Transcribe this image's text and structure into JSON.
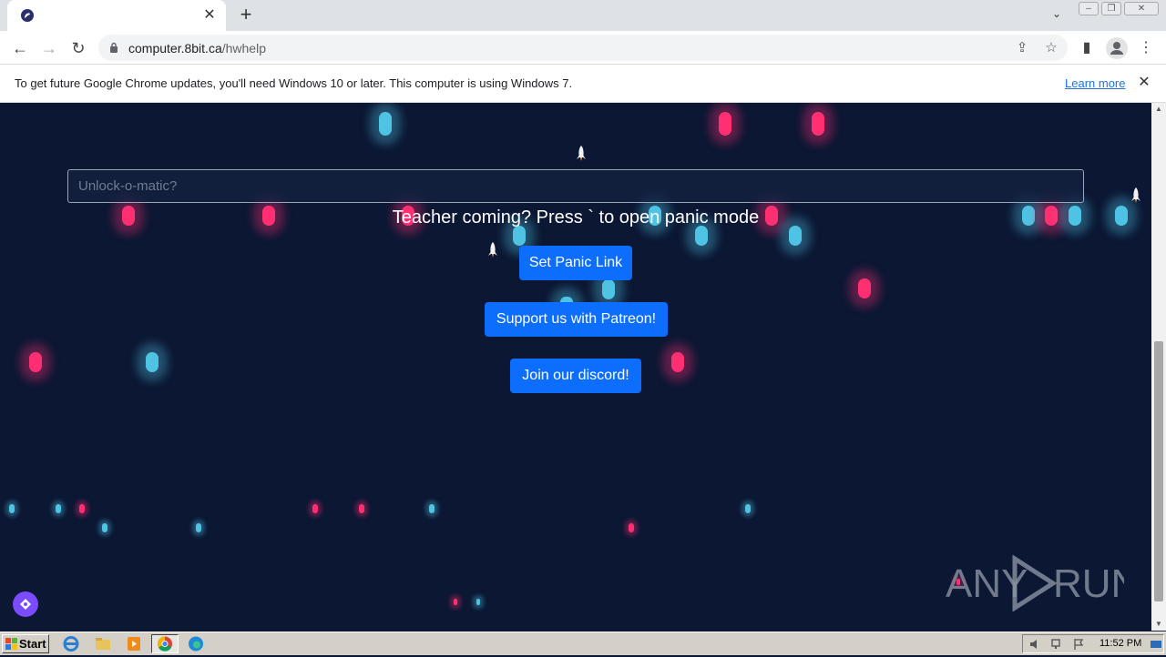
{
  "browser": {
    "tab_close_glyph": "✕",
    "new_tab_glyph": "+",
    "tab_list_glyph": "⌄",
    "window_buttons": {
      "minimize": "–",
      "restore": "❐",
      "close": "✕"
    },
    "nav": {
      "back": "←",
      "forward": "→",
      "reload": "↻"
    },
    "url_host": "computer.8bit.ca",
    "url_path": "/hwhelp",
    "toolbar_icons": {
      "share": "⇪",
      "bookmark": "☆",
      "side_panel": "▮",
      "menu": "⋮"
    }
  },
  "infobar": {
    "message": "To get future Google Chrome updates, you'll need Windows 10 or later. This computer is using Windows 7.",
    "link": "Learn more",
    "close_glyph": "✕"
  },
  "page": {
    "search_placeholder": "Unlock-o-matic?",
    "panic_text": "Teacher coming? Press ` to open panic mode",
    "set_panic_button": "Set Panic Link",
    "patreon_button": "Support us with Patreon!",
    "discord_button": "Join our discord!",
    "watermark": "ANY RUN"
  },
  "colors": {
    "page_bg": "#0b1733",
    "button_blue": "#0d6efd",
    "pill_cyan": "#4fc3e3",
    "pill_pink": "#ff2f72",
    "fab_purple": "#7b4bff"
  },
  "taskbar": {
    "start_label": "Start",
    "clock": "11:52 PM"
  }
}
